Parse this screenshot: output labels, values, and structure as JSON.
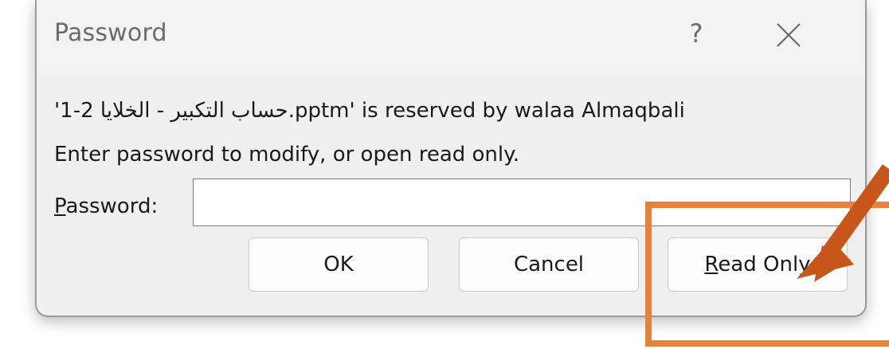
{
  "dialog": {
    "title": "Password",
    "help_glyph": "?",
    "message_line1": "'1-2 حساب التكبير - الخلايا.pptm' is reserved by walaa Almaqbali",
    "message_line2": "Enter password to modify, or open read only.",
    "password_label_mnemonic": "P",
    "password_label_rest": "assword:",
    "password_value": ""
  },
  "buttons": {
    "ok_label": "OK",
    "cancel_label": "Cancel",
    "readonly_mnemonic": "R",
    "readonly_rest": "ead Only"
  },
  "icons": {
    "help": "question-mark-icon",
    "close": "close-x-icon",
    "annotation_arrow": "arrow-annotation-icon"
  },
  "colors": {
    "dialog_background": "#f0f0f0",
    "highlight": "#e8823a",
    "arrow": "#c8561a"
  }
}
